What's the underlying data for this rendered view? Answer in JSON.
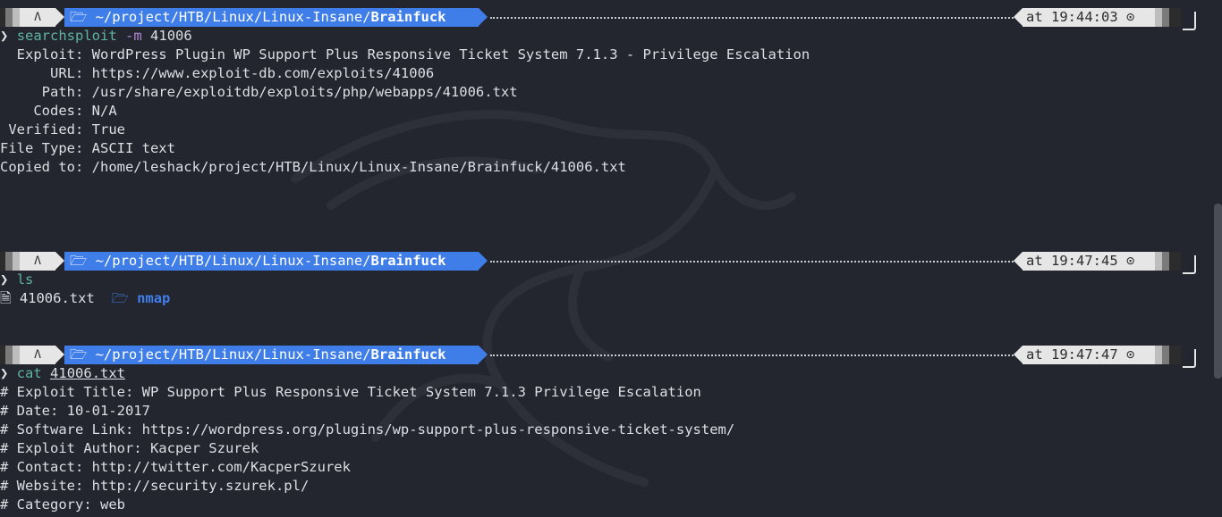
{
  "prompts": [
    {
      "user_icon": "Λ",
      "folder_icon": "🗁",
      "path": "~/project/HTB/Linux/Linux-Insane/",
      "dir": "Brainfuck",
      "time_prefix": "at",
      "time": "19:44:03",
      "clock_icon": "⊙"
    },
    {
      "user_icon": "Λ",
      "folder_icon": "🗁",
      "path": "~/project/HTB/Linux/Linux-Insane/",
      "dir": "Brainfuck",
      "time_prefix": "at",
      "time": "19:47:45",
      "clock_icon": "⊙"
    },
    {
      "user_icon": "Λ",
      "folder_icon": "🗁",
      "path": "~/project/HTB/Linux/Linux-Insane/",
      "dir": "Brainfuck",
      "time_prefix": "at",
      "time": "19:47:47",
      "clock_icon": "⊙"
    }
  ],
  "prompt_char": "❯",
  "commands": {
    "c1": {
      "name": "searchsploit",
      "flag": "-m",
      "arg": "41006"
    },
    "c2": {
      "name": "ls"
    },
    "c3": {
      "name": "cat",
      "arg": "41006.txt"
    }
  },
  "searchsploit_output": [
    "  Exploit: WordPress Plugin WP Support Plus Responsive Ticket System 7.1.3 - Privilege Escalation",
    "      URL: https://www.exploit-db.com/exploits/41006",
    "     Path: /usr/share/exploitdb/exploits/php/webapps/41006.txt",
    "    Codes: N/A",
    " Verified: True",
    "File Type: ASCII text",
    "Copied to: /home/leshack/project/HTB/Linux/Linux-Insane/Brainfuck/41006.txt"
  ],
  "ls_output": {
    "file_icon": "🗎",
    "file": "41006.txt",
    "folder_icon": "🗁",
    "folder": "nmap"
  },
  "cat_output": [
    "# Exploit Title: WP Support Plus Responsive Ticket System 7.1.3 Privilege Escalation",
    "# Date: 10-01-2017",
    "# Software Link: https://wordpress.org/plugins/wp-support-plus-responsive-ticket-system/",
    "# Exploit Author: Kacper Szurek",
    "# Contact: http://twitter.com/KacperSzurek",
    "# Website: http://security.szurek.pl/",
    "# Category: web"
  ],
  "colors": {
    "background": "#23262e",
    "path_segment": "#3f7ee8",
    "command": "#5fb3a3",
    "flag": "#b08ad6",
    "text": "#dcdfe4"
  }
}
